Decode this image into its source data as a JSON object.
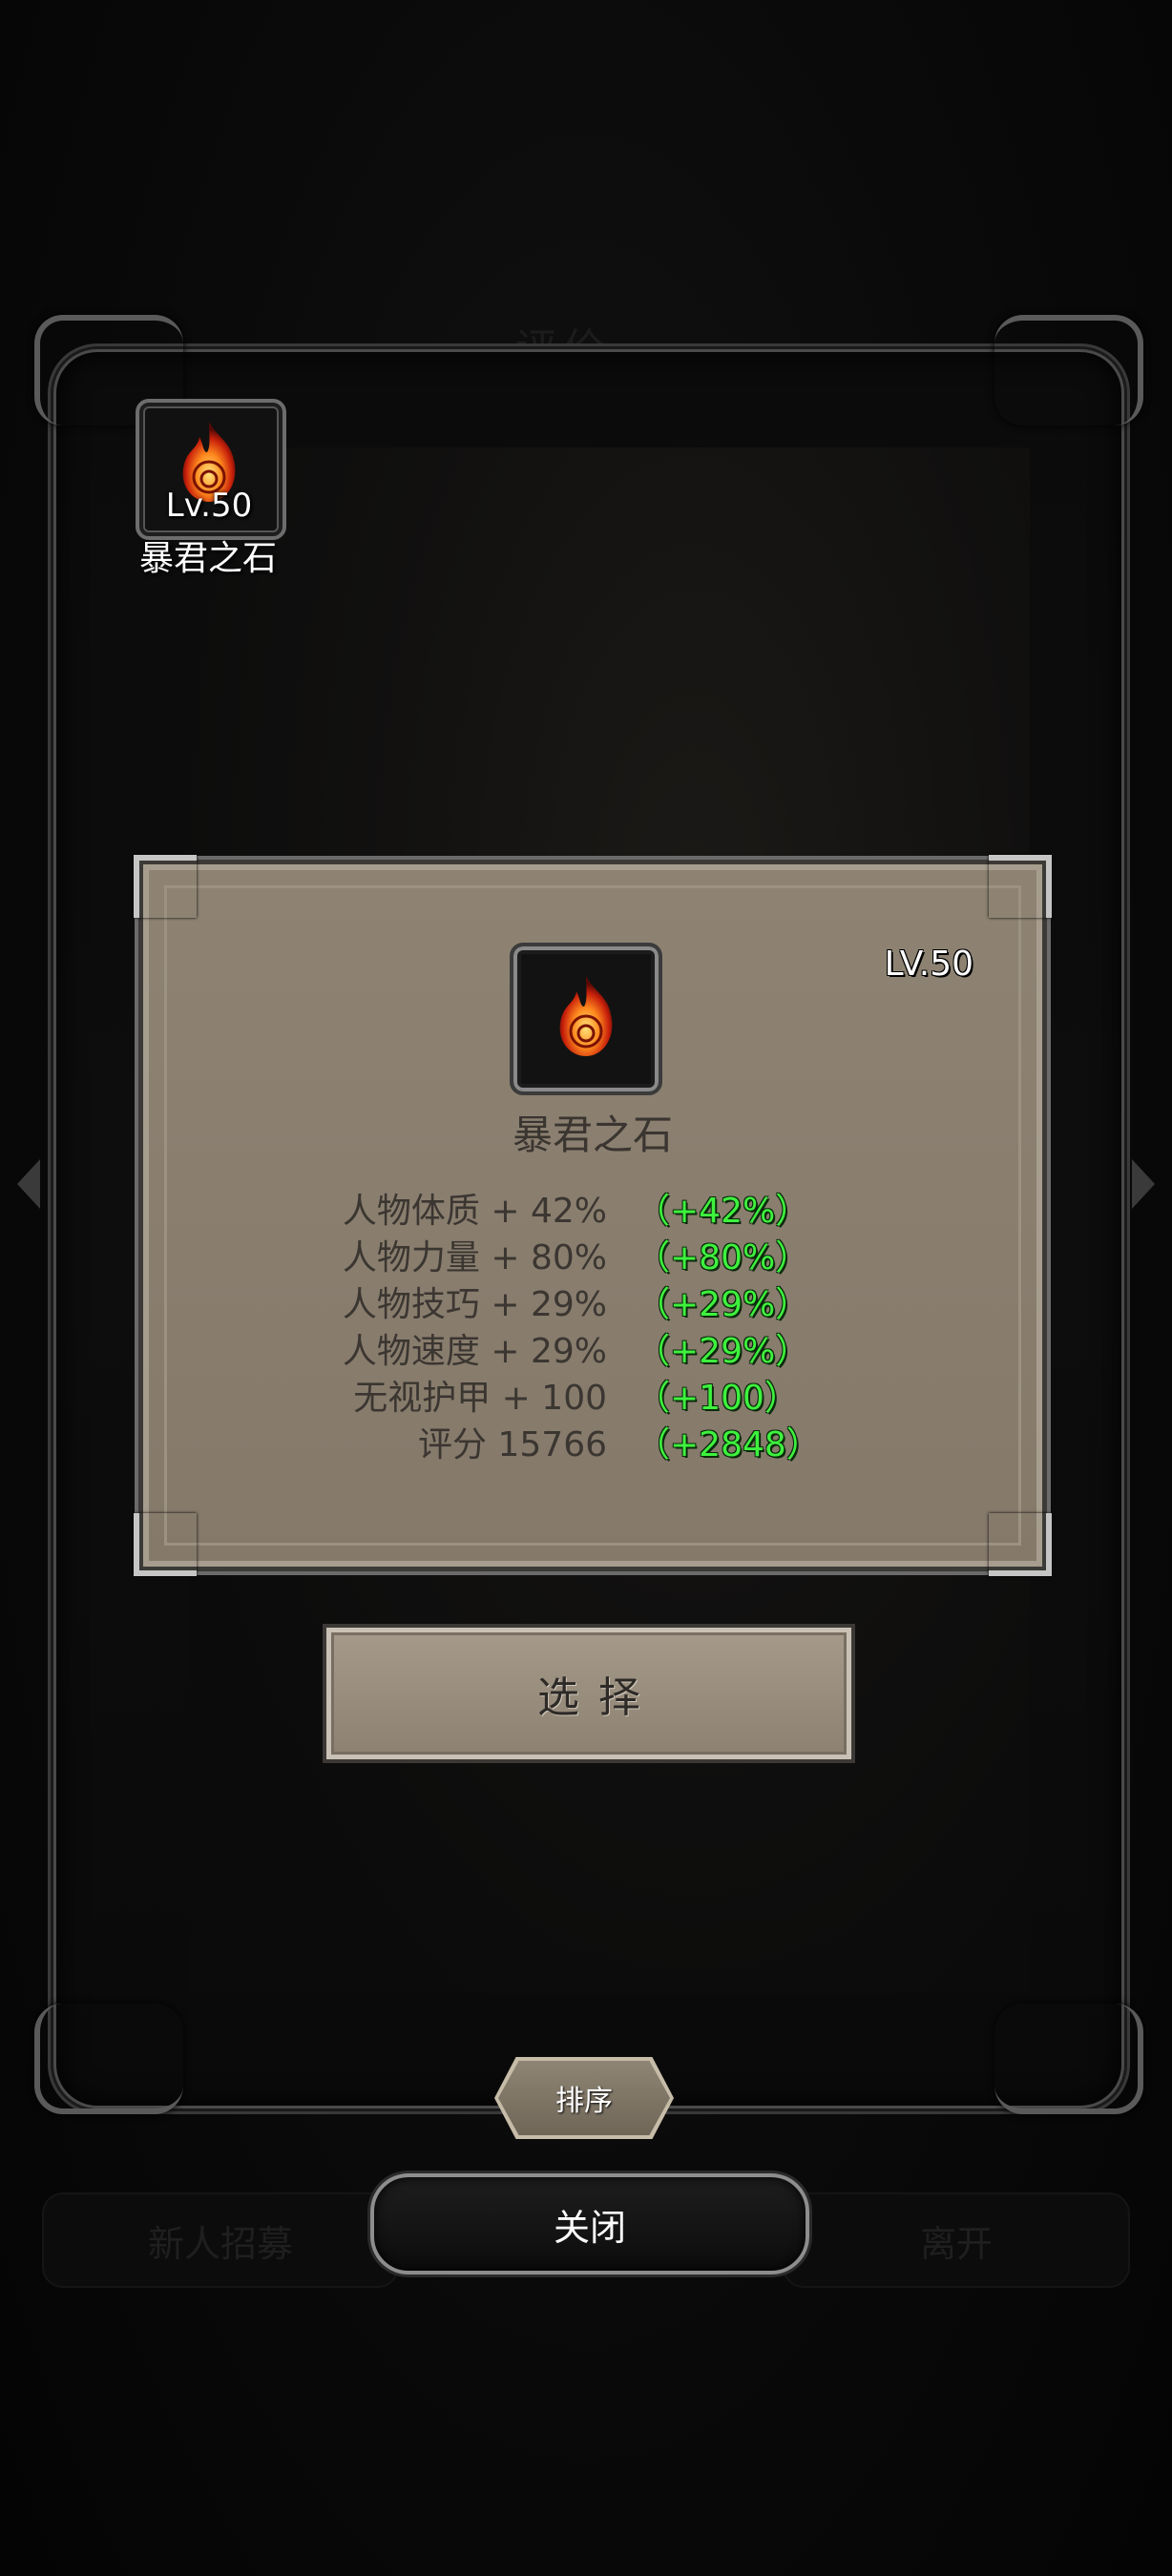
{
  "background": {
    "title": "评价",
    "left_button": "新人招募",
    "right_button": "离开"
  },
  "slot": {
    "level": "Lv.50",
    "name": "暴君之石",
    "icon": "fire-stone-icon"
  },
  "detail": {
    "level": "LV.50",
    "name": "暴君之石",
    "icon": "fire-stone-icon",
    "stats": [
      {
        "label": "人物体质 + 42%",
        "bonus": "（+42%）"
      },
      {
        "label": "人物力量 + 80%",
        "bonus": "（+80%）"
      },
      {
        "label": "人物技巧 + 29%",
        "bonus": "（+29%）"
      },
      {
        "label": "人物速度 + 29%",
        "bonus": "（+29%）"
      },
      {
        "label": "无视护甲 + 100",
        "bonus": "（+100）"
      },
      {
        "label": "评分 15766",
        "bonus": "（+2848）"
      }
    ]
  },
  "buttons": {
    "select": "选择",
    "sort": "排序",
    "close": "关闭"
  },
  "colors": {
    "panel": "#8b8070",
    "bonus_green": "#3ef23e",
    "frame": "#0b0b0b"
  }
}
